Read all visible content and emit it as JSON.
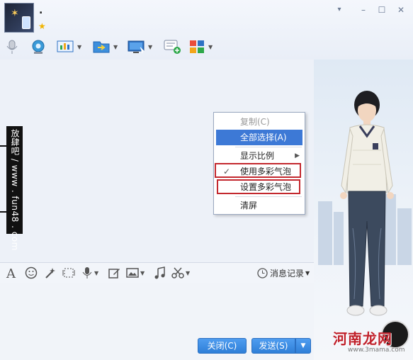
{
  "header": {
    "nickname": ".",
    "window_buttons": [
      "▾",
      "–",
      "☐",
      "✕"
    ],
    "toolbar_icons": [
      "microphone-icon",
      "video-camera-icon",
      "screen-share-icon",
      "file-transfer-icon",
      "remote-desktop-icon",
      "send-sms-icon",
      "apps-grid-icon"
    ]
  },
  "banner": {
    "text": "放肆吧 / www . fun48 . com"
  },
  "context_menu": {
    "items": [
      {
        "label": "复制(C)",
        "state": "disabled"
      },
      {
        "label": "全部选择(A)",
        "state": "selected"
      },
      {
        "label": "显示比例",
        "state": "submenu"
      },
      {
        "label": "使用多彩气泡",
        "state": "checked"
      },
      {
        "label": "设置多彩气泡",
        "state": "normal"
      },
      {
        "label": "清屏",
        "state": "normal"
      }
    ]
  },
  "input_toolbar": {
    "icons": [
      "font-icon",
      "emoji-icon",
      "magic-wand-icon",
      "screen-capture-icon",
      "voice-icon",
      "edit-icon",
      "image-icon",
      "music-icon",
      "scissors-icon"
    ],
    "history_label": "消息记录"
  },
  "actions": {
    "close_label": "关闭(C)",
    "send_label": "发送(S)"
  },
  "watermark": {
    "text": "河南龙网",
    "url": "www.3mama.com"
  },
  "colors": {
    "accent_blue": "#3d79d6",
    "highlight_red": "#c3282e"
  }
}
